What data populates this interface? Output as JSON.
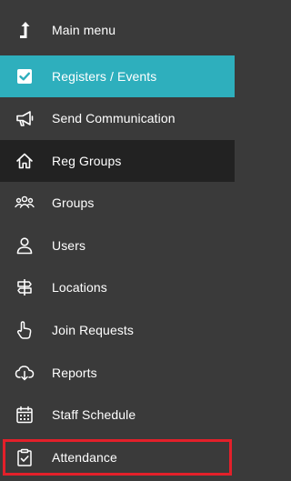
{
  "sidebar": {
    "items": [
      {
        "label": "Main menu",
        "icon": "arrow-up-icon"
      },
      {
        "label": "Registers / Events",
        "icon": "checkbox-checked-icon",
        "state": "active"
      },
      {
        "label": "Send Communication",
        "icon": "megaphone-icon"
      },
      {
        "label": "Reg Groups",
        "icon": "home-icon",
        "state": "hover"
      },
      {
        "label": "Groups",
        "icon": "people-group-icon"
      },
      {
        "label": "Users",
        "icon": "user-icon"
      },
      {
        "label": "Locations",
        "icon": "signpost-icon"
      },
      {
        "label": "Join Requests",
        "icon": "hand-pointer-icon"
      },
      {
        "label": "Reports",
        "icon": "cloud-download-icon"
      },
      {
        "label": "Staff Schedule",
        "icon": "calendar-icon"
      },
      {
        "label": "Attendance",
        "icon": "clipboard-check-icon"
      }
    ]
  },
  "colors": {
    "background": "#3a3a3a",
    "active": "#2eafbd",
    "hover": "#222222",
    "highlight_border": "#e3202a",
    "text": "#ffffff"
  }
}
